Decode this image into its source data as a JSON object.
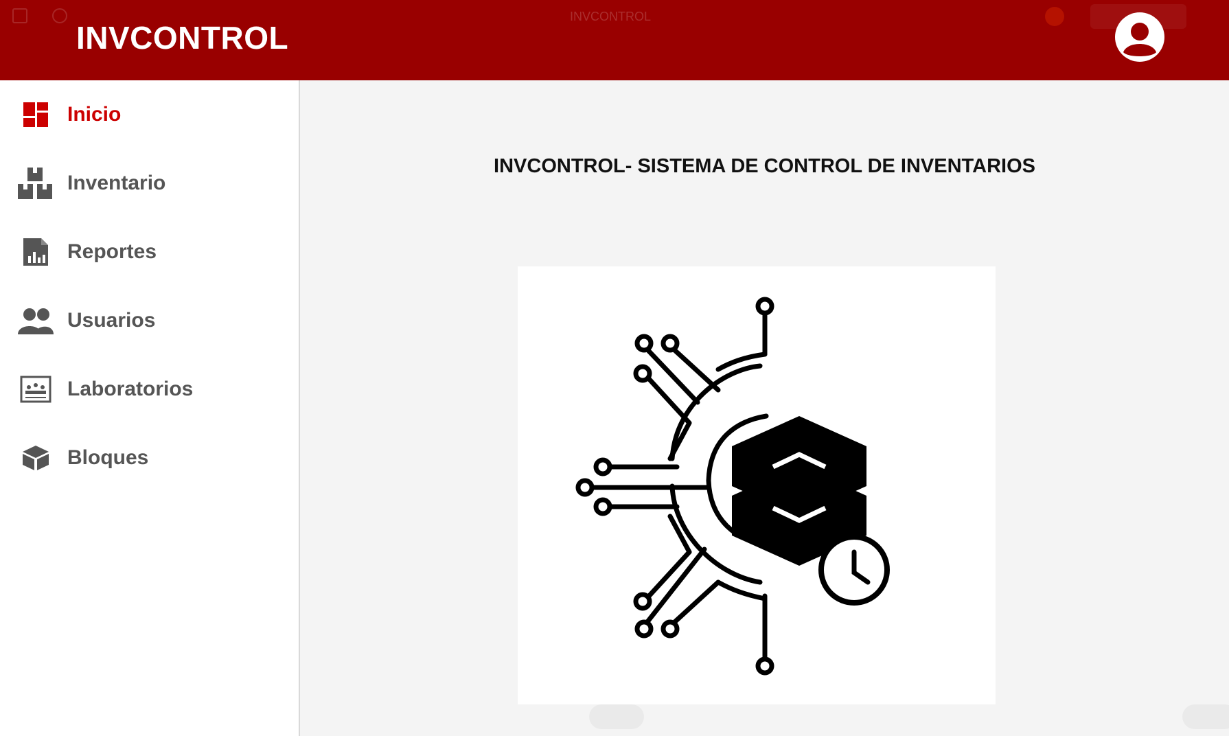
{
  "header": {
    "brand": "INVCONTROL",
    "ghost_title": "INVCONTROL"
  },
  "sidebar": {
    "items": [
      {
        "label": "Inicio",
        "icon": "dashboard-icon",
        "active": true
      },
      {
        "label": "Inventario",
        "icon": "boxes-icon",
        "active": false
      },
      {
        "label": "Reportes",
        "icon": "report-icon",
        "active": false
      },
      {
        "label": "Usuarios",
        "icon": "users-icon",
        "active": false
      },
      {
        "label": "Laboratorios",
        "icon": "lab-icon",
        "active": false
      },
      {
        "label": "Bloques",
        "icon": "cube-icon",
        "active": false
      }
    ]
  },
  "main": {
    "title": "INVCONTROL- SISTEMA DE CONTROL DE INVENTARIOS"
  },
  "colors": {
    "header_bg": "#990000",
    "active": "#cc0000",
    "nav_text": "#555555"
  }
}
